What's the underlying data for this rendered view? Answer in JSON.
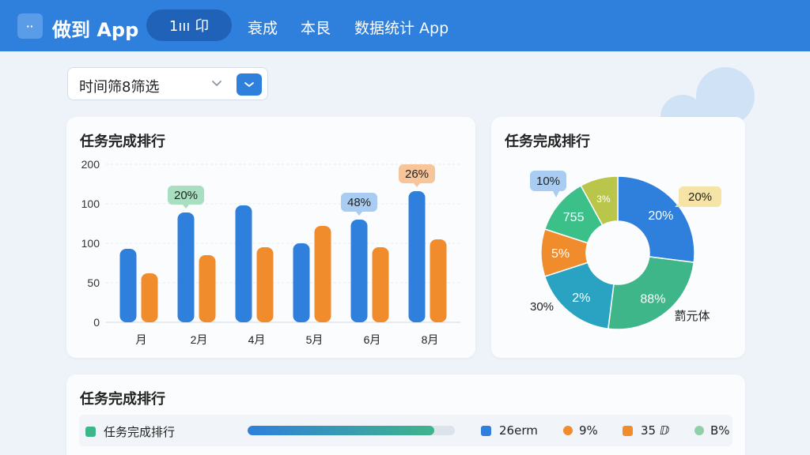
{
  "header": {
    "logo_glyph": "··",
    "app_title": "做到 App",
    "nav_pill_label": "1ııı 卬",
    "nav_items": [
      "衰成",
      "本艮",
      "数据统计 App"
    ]
  },
  "filter": {
    "label": "时间筛8筛选"
  },
  "bar_card": {
    "title": "任务完成排行"
  },
  "donut_card": {
    "title": "任务完成排行"
  },
  "bottom_card": {
    "title": "任务完成排行"
  },
  "legend": {
    "row_label": "任务完成排行",
    "progress": 0.9,
    "items": [
      {
        "label": "26erm",
        "color": "#2f7fdc",
        "shape": "square"
      },
      {
        "label": "9%",
        "color": "#f08c2c",
        "shape": "dot"
      },
      {
        "label": "35 ⅅ",
        "color": "#f08c2c",
        "shape": "square"
      },
      {
        "label": "B%",
        "color": "#8fd0a8",
        "shape": "dot"
      }
    ],
    "row_color": "#3fb58a"
  },
  "colors": {
    "primary": "#2f7fdc",
    "orange": "#f08c2c",
    "green": "#3fb58a",
    "teal": "#2aa3c2"
  },
  "chart_data": [
    {
      "type": "bar",
      "title": "任务完成排行",
      "categories": [
        "月",
        "2月",
        "4月",
        "5月",
        "6月",
        "8月"
      ],
      "y_ticks": [
        "200",
        "100",
        "100",
        "50",
        "0"
      ],
      "ylim": [
        0,
        200
      ],
      "grid": true,
      "series": [
        {
          "values": [
            93,
            139,
            148,
            100,
            130,
            166
          ],
          "color": "#2f7fdc"
        },
        {
          "values": [
            62,
            85,
            95,
            122,
            95,
            105
          ],
          "color": "#f08c2c"
        }
      ],
      "annotations": [
        {
          "category_index": 1,
          "text": "20%",
          "color": "#a8dfc0"
        },
        {
          "category_index": 4,
          "text": "48%",
          "color": "#a9cdf2"
        },
        {
          "category_index": 5,
          "text": "26%",
          "color": "#f8c49a"
        }
      ]
    },
    {
      "type": "pie",
      "title": "任务完成排行",
      "slices": [
        {
          "label": "20%",
          "value": 27,
          "color": "#2f7fdc"
        },
        {
          "label": "88%",
          "value": 25,
          "color": "#3fb58a"
        },
        {
          "label": "2%",
          "value": 18,
          "color": "#2aa3c2"
        },
        {
          "label": "5%",
          "value": 10,
          "color": "#f08c2c"
        },
        {
          "label": "755",
          "value": 12,
          "color": "#3cc08a"
        },
        {
          "label": "3%",
          "value": 8,
          "color": "#b9c64a"
        }
      ],
      "callouts": [
        {
          "text": "10%",
          "color": "#a9cdf2"
        },
        {
          "text": "20%",
          "color": "#f6e3a6"
        },
        {
          "text": "30%",
          "color": ""
        },
        {
          "text": "藅元体",
          "color": ""
        }
      ]
    }
  ]
}
